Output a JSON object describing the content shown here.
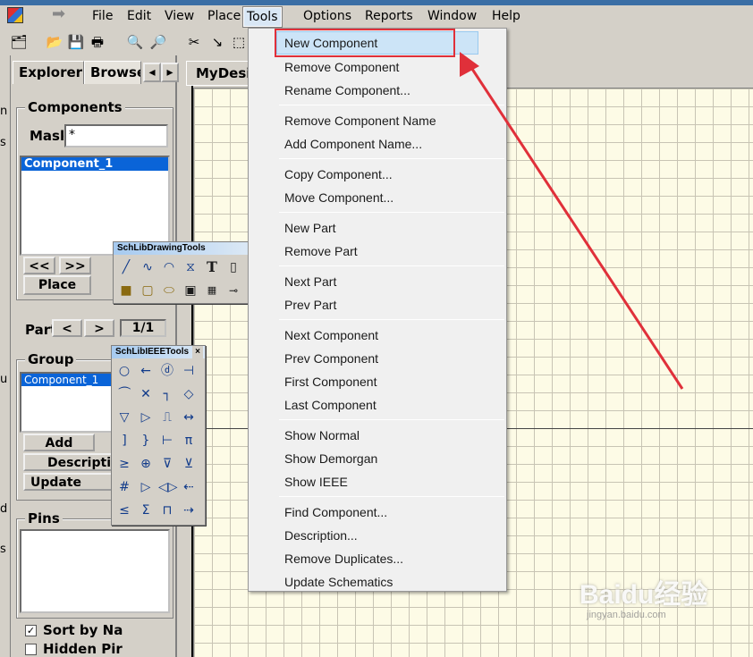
{
  "menubar": {
    "items": [
      "File",
      "Edit",
      "View",
      "Place",
      "Tools",
      "Options",
      "Reports",
      "Window",
      "Help"
    ],
    "active": "Tools"
  },
  "left_strip_letters": [
    "n",
    "s",
    "u",
    "d",
    "s"
  ],
  "side_panel": {
    "tabs": [
      "Explorer",
      "Browse"
    ],
    "components_group": "Components",
    "mask_label": "Mask",
    "mask_value": "*",
    "component_list": [
      "Component_1"
    ],
    "nav_prev": "<<",
    "nav_next": ">>",
    "place_button": "Place",
    "part_label": "Part",
    "part_prev": "<",
    "part_next": ">",
    "part_counter": "1/1",
    "group_label": "Group",
    "group_list": [
      "Component_1"
    ],
    "add_button": "Add",
    "description_button": "Descripti",
    "update_button": "Update Sch",
    "pins_label": "Pins",
    "sort_checkbox": "Sort by Na",
    "sort_checked": true,
    "hidden_checkbox": "Hidden Pir",
    "hidden_checked": false
  },
  "document_tab": "MyDesi",
  "drawing_toolbar": {
    "title": "SchLibDrawingTools",
    "icons": [
      "line-icon",
      "bezier-icon",
      "arc-icon",
      "polygon-icon",
      "text-icon",
      "part-icon",
      "rectangle-icon",
      "rounded-rect-icon",
      "ellipse-icon",
      "image-icon",
      "array-icon",
      "pin-icon"
    ]
  },
  "ieee_toolbar": {
    "title": "SchLibIEEETools",
    "close": "×"
  },
  "tools_menu": {
    "groups": [
      [
        "New Component",
        "Remove Component",
        "Rename Component..."
      ],
      [
        "Remove Component Name",
        "Add Component Name..."
      ],
      [
        "Copy Component...",
        "Move Component..."
      ],
      [
        "New Part",
        "Remove Part"
      ],
      [
        "Next Part",
        "Prev Part"
      ],
      [
        "Next Component",
        "Prev Component",
        "First Component",
        "Last Component"
      ],
      [
        "Show Normal",
        "Show Demorgan",
        "Show IEEE"
      ],
      [
        "Find Component...",
        "Description...",
        "Remove Duplicates...",
        "Update Schematics"
      ]
    ],
    "highlighted": "New Component"
  },
  "annotation_color": "#e0303a",
  "watermark": {
    "logo": "Baidu经验",
    "url": "jingyan.baidu.com"
  }
}
